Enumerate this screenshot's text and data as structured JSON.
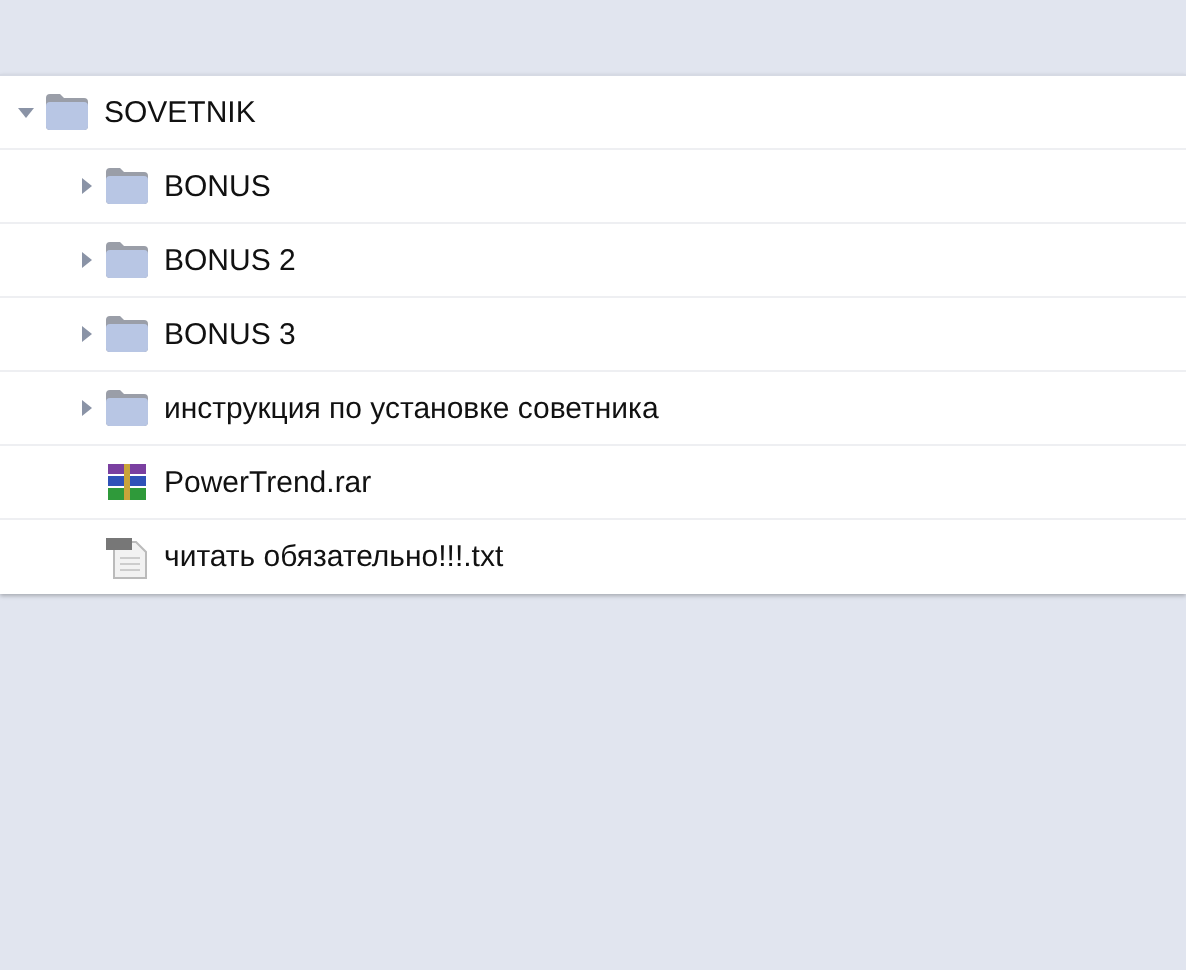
{
  "tree": [
    {
      "name": "SOVETNIK",
      "kind": "folder",
      "expanded": true,
      "children": [
        {
          "name": "BONUS",
          "kind": "folder",
          "expanded": false
        },
        {
          "name": "BONUS 2",
          "kind": "folder",
          "expanded": false
        },
        {
          "name": "BONUS 3",
          "kind": "folder",
          "expanded": false
        },
        {
          "name": "инструкция по установке советника",
          "kind": "folder",
          "expanded": false
        },
        {
          "name": "PowerTrend.rar",
          "kind": "archive"
        },
        {
          "name": "читать обязательно!!!.txt",
          "kind": "text"
        }
      ]
    }
  ]
}
